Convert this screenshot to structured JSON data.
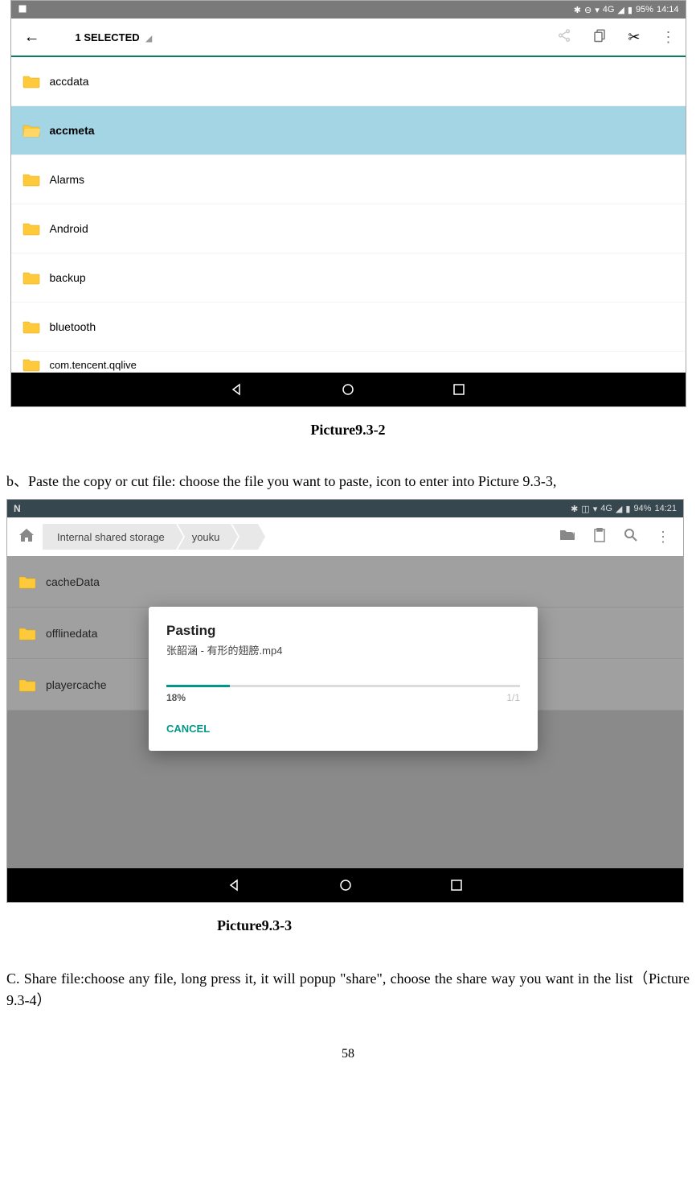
{
  "ss1": {
    "status": {
      "signal": "4G",
      "battery": "95%",
      "time": "14:14"
    },
    "appbar": {
      "title": "1 SELECTED"
    },
    "folders": [
      {
        "name": "accdata",
        "selected": false
      },
      {
        "name": "accmeta",
        "selected": true
      },
      {
        "name": "Alarms",
        "selected": false
      },
      {
        "name": "Android",
        "selected": false
      },
      {
        "name": "backup",
        "selected": false
      },
      {
        "name": "bluetooth",
        "selected": false
      },
      {
        "name": "com.tencent.qqlive",
        "selected": false
      }
    ]
  },
  "caption1": "Picture9.3-2",
  "para_b": "b、Paste the copy or cut file: choose the file you want to paste,    icon to enter into Picture 9.3-3,",
  "ss2": {
    "status": {
      "signal": "4G",
      "battery": "94%",
      "time": "14:21"
    },
    "breadcrumb": [
      "Internal shared storage",
      "youku"
    ],
    "folders": [
      {
        "name": "cacheData"
      },
      {
        "name": "offlinedata"
      },
      {
        "name": "playercache"
      }
    ],
    "dialog": {
      "title": "Pasting",
      "subtitle": "张韶涵 - 有形的翅膀.mp4",
      "percent": "18%",
      "count": "1/1",
      "cancel": "CANCEL"
    }
  },
  "caption2": "Picture9.3-3",
  "para_c": "C. Share file:choose any file, long press it, it will popup \"share\", choose the share way you want in the list（Picture 9.3-4）",
  "page_num": "58"
}
